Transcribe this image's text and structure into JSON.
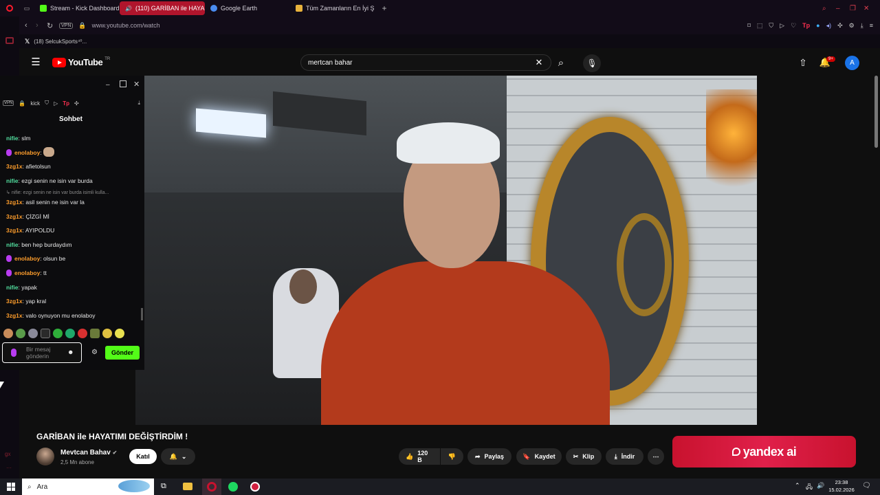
{
  "browser": {
    "tabs": [
      {
        "label": "Stream - Kick Dashboard",
        "color": "#53fc18"
      },
      {
        "label": "(110) GARİBAN ile HAYA",
        "color": "#ff0033",
        "active": true
      },
      {
        "label": "Google Earth",
        "color": "#4a8cf0"
      },
      {
        "label": "Tüm Zamanların En İyi Şarkı",
        "color": "#e8b23c"
      }
    ],
    "vpn_badge": "VPN",
    "url": "www.youtube.com/watch",
    "bookmark": "(18) SelcukSports⁴⁰..."
  },
  "youtube": {
    "logo_text": "YouTube",
    "region": "TR",
    "search_value": "mertcan bahar",
    "notif_count": "9+",
    "avatar_letter": "A",
    "video_title": "GARİBAN ile HAYATIMI DEĞİŞTİRDİM !",
    "channel_name": "Mevtcan Bahav",
    "subscribers": "2,5 Mn abone",
    "join_label": "Katıl",
    "like_count": "120 B",
    "share_label": "Paylaş",
    "save_label": "Kaydet",
    "clip_label": "Klip",
    "download_label": "İndir",
    "ad_text": "yandex ai"
  },
  "kick": {
    "toolbar_vpn": "VPN",
    "toolbar_label": "kick",
    "chat_title": "Sohbet",
    "reply_preview": "nifie: ezgi senin ne isin var burda isimli kulla...",
    "messages": [
      {
        "user": "nifie",
        "text": "slm",
        "color": "green2"
      },
      {
        "user": "enolaboy",
        "text": "",
        "color": "orange",
        "mic": true
      },
      {
        "user": "3zg1x",
        "text": "afietolsun",
        "color": "orange"
      },
      {
        "user": "nifie",
        "text": "ezgi senin ne isin var burda",
        "color": "green2"
      },
      {
        "user": "3zg1x",
        "text": "asil senin ne isin var la",
        "color": "orange"
      },
      {
        "user": "3zg1x",
        "text": "ÇİZGİ Mİ",
        "color": "orange"
      },
      {
        "user": "3zg1x",
        "text": "AYIPOLDU",
        "color": "orange"
      },
      {
        "user": "nifie",
        "text": "ben hep burdaydım",
        "color": "green2"
      },
      {
        "user": "enolaboy",
        "text": "olsun be",
        "color": "orange",
        "mic": true
      },
      {
        "user": "enolaboy",
        "text": "tt",
        "color": "orange",
        "mic": true
      },
      {
        "user": "nifie",
        "text": "yapak",
        "color": "green2"
      },
      {
        "user": "3zg1x",
        "text": "yap kral",
        "color": "orange"
      },
      {
        "user": "3zg1x",
        "text": "valo oynuyon mu enolaboy",
        "color": "orange"
      }
    ],
    "input_placeholder": "Bir mesaj gönderin",
    "send_label": "Gönder"
  },
  "taskbar": {
    "search_placeholder": "Ara",
    "time": "23:38",
    "date": "15.02.2026"
  }
}
